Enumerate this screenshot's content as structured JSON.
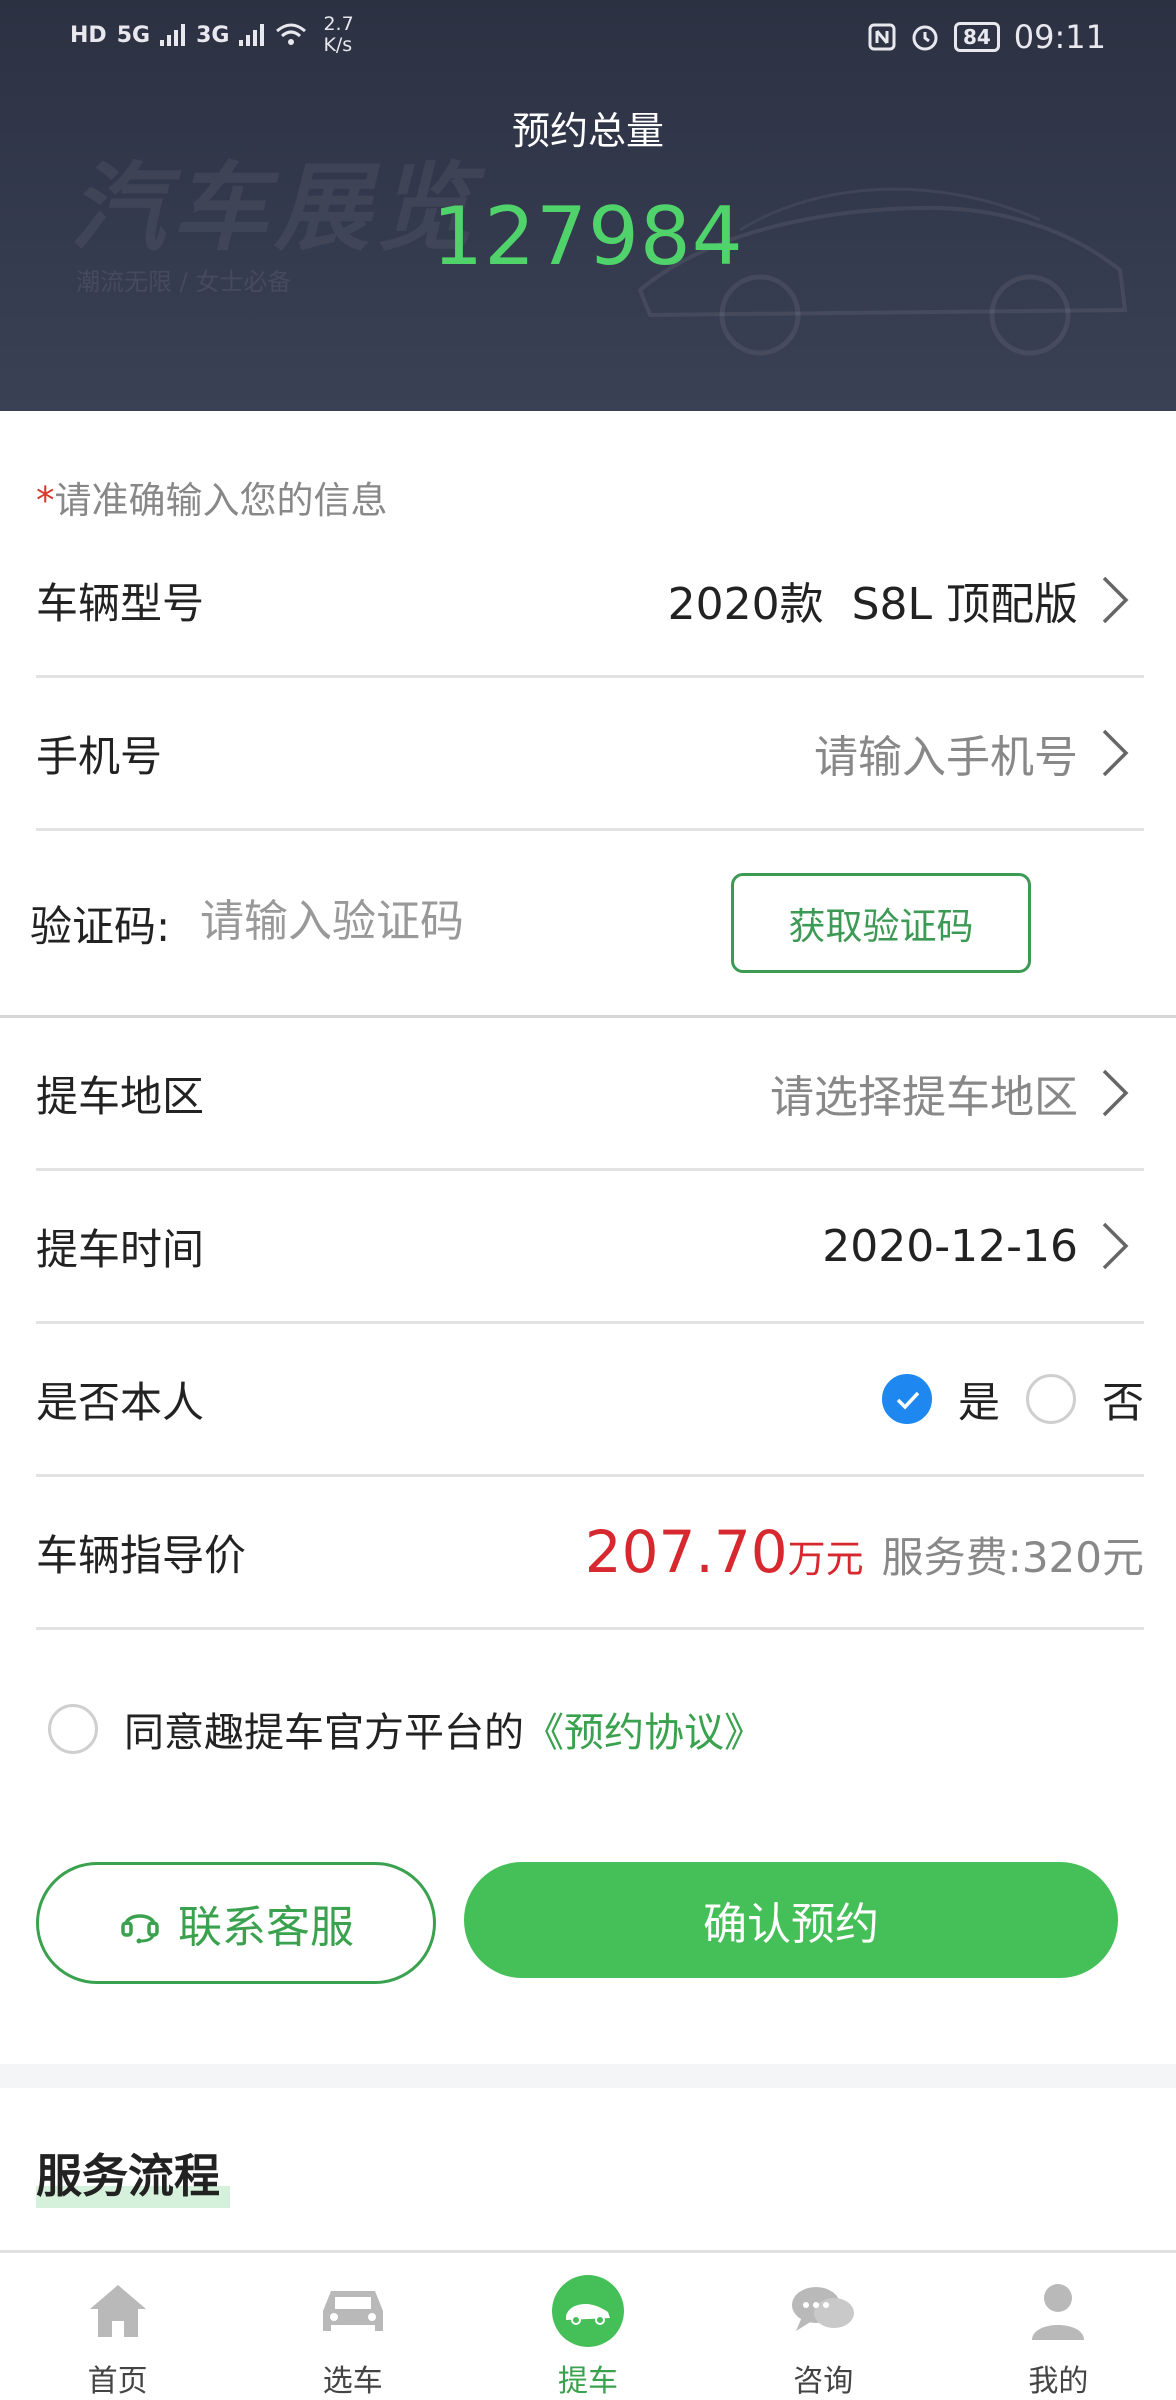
{
  "status_bar": {
    "left_badges": [
      "HD",
      "5G",
      "3G"
    ],
    "net_speed": "2.7",
    "net_speed_unit": "K/s",
    "battery": "84",
    "time": "09:11"
  },
  "header": {
    "total_label": "预约总量",
    "total_value": "127984"
  },
  "form": {
    "tip_star": "*",
    "tip_text": "请准确输入您的信息",
    "vehicle_model": {
      "label": "车辆型号",
      "value": "2020款  S8L 顶配版"
    },
    "phone": {
      "label": "手机号",
      "placeholder": "请输入手机号"
    },
    "code": {
      "label": "验证码:",
      "placeholder": "请输入验证码",
      "button": "获取验证码"
    },
    "region": {
      "label": "提车地区",
      "placeholder": "请选择提车地区"
    },
    "pickup_time": {
      "label": "提车时间",
      "value": "2020-12-16"
    },
    "self": {
      "label": "是否本人",
      "yes": "是",
      "no": "否",
      "selected": "是"
    },
    "price": {
      "label": "车辆指导价",
      "value": "207.70",
      "unit": "万元",
      "fee": "服务费:320元"
    }
  },
  "agreement": {
    "checked": false,
    "text": "同意趣提车官方平台的",
    "link": "《预约协议》"
  },
  "actions": {
    "service_label": "联系客服",
    "confirm_label": "确认预约"
  },
  "section": {
    "title": "服务流程"
  },
  "tabbar": {
    "items": [
      {
        "label": "首页",
        "icon": "home-icon",
        "active": false
      },
      {
        "label": "选车",
        "icon": "car-icon",
        "active": false
      },
      {
        "label": "提车",
        "icon": "pickup-car-icon",
        "active": true
      },
      {
        "label": "咨询",
        "icon": "chat-icon",
        "active": false
      },
      {
        "label": "我的",
        "icon": "user-icon",
        "active": false
      }
    ]
  },
  "colors": {
    "accent_green": "#45bf58",
    "total_green": "#4fd36a",
    "price_red": "#d6282e",
    "check_blue": "#1e88f0",
    "header_bg": "#2c3142"
  }
}
